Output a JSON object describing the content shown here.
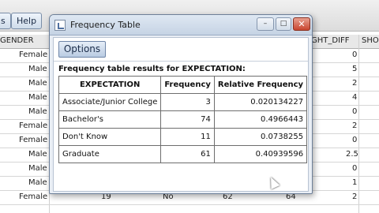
{
  "toolbar": {
    "left_button_label": "s",
    "help_label": "Help"
  },
  "grid": {
    "headers": {
      "gender": "GENDER",
      "diff": "GHT_DIFF",
      "short": "SHO"
    },
    "rows": [
      {
        "gender": "Female",
        "diff": "0"
      },
      {
        "gender": "Male",
        "diff": "5"
      },
      {
        "gender": "Male",
        "diff": "2"
      },
      {
        "gender": "Male",
        "diff": "4"
      },
      {
        "gender": "Male",
        "diff": "0"
      },
      {
        "gender": "Female",
        "diff": "2"
      },
      {
        "gender": "Female",
        "diff": "0"
      },
      {
        "gender": "Male",
        "diff": "2.5"
      },
      {
        "gender": "Male",
        "diff": "0"
      },
      {
        "gender": "Male",
        "diff": "1"
      },
      {
        "gender": "Female",
        "c2": "19",
        "c3": "No",
        "c4": "62",
        "c5": "64",
        "diff": "2"
      }
    ]
  },
  "dialog": {
    "title": "Frequency Table",
    "options_label": "Options",
    "results_title": "Frequency table results for EXPECTATION:",
    "table": {
      "headers": [
        "EXPECTATION",
        "Frequency",
        "Relative Frequency"
      ],
      "rows": [
        [
          "Associate/Junior College",
          "3",
          "0.020134227"
        ],
        [
          "Bachelor's",
          "74",
          "0.4966443"
        ],
        [
          "Don't Know",
          "11",
          "0.0738255"
        ],
        [
          "Graduate",
          "61",
          "0.40939596"
        ]
      ]
    }
  }
}
